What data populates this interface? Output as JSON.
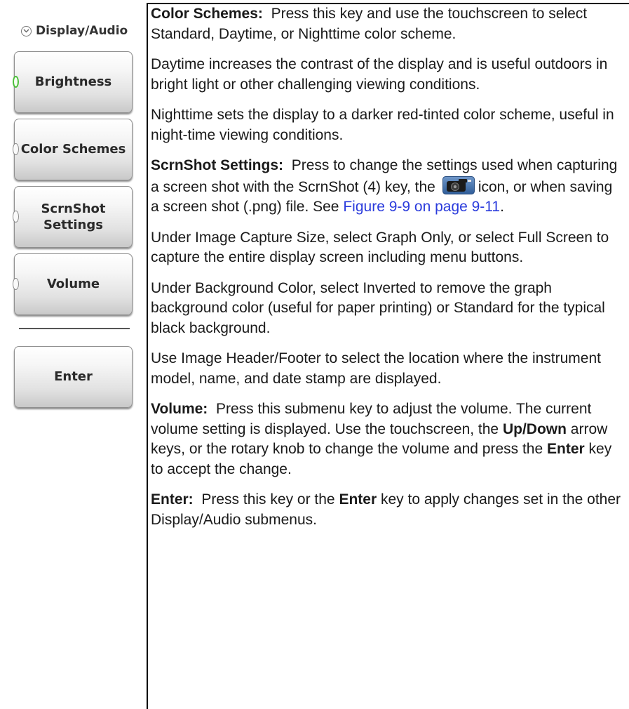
{
  "menu": {
    "title": "Display/Audio",
    "items": [
      {
        "label": "Brightness",
        "active": true
      },
      {
        "label": "Color Schemes",
        "active": false
      },
      {
        "label": "ScrnShot\nSettings",
        "active": false
      },
      {
        "label": "Volume",
        "active": false
      }
    ],
    "enter_label": "Enter"
  },
  "doc": {
    "color_schemes": {
      "term": "Color Schemes:",
      "text": "Press this key and use the touchscreen to select Standard, Daytime, or Nighttime color scheme."
    },
    "daytime_text": "Daytime increases the contrast of the display and is useful outdoors in bright light or other challenging viewing conditions.",
    "nighttime_text": "Nighttime sets the display to a darker red-tinted color scheme, useful in night-time viewing conditions.",
    "scrnshot": {
      "term": "ScrnShot Settings:",
      "text_before_icon": "Press to change the settings used when capturing a screen shot with the ScrnShot (4) key, the",
      "text_after_icon": "icon, or when saving a screen shot (.png) file.",
      "see": "See",
      "link": "Figure 9-9 on page 9-11",
      "period": "."
    },
    "image_capture_text": "Under Image Capture Size, select Graph Only, or select Full Screen to capture the entire display screen including menu buttons.",
    "background_color_text": "Under Background Color, select Inverted to remove the graph background color (useful for paper printing) or Standard for the typical black background.",
    "header_footer_text": "Use Image Header/Footer to select the location where the instrument model, name, and date stamp are displayed.",
    "volume": {
      "term": "Volume:",
      "text1": "Press this submenu key to adjust the volume. The current volume setting is displayed. Use the touchscreen, the",
      "bold1": "Up/Down",
      "text2": "arrow keys, or the rotary knob to change the volume and press the",
      "bold2": "Enter",
      "text3": "key to accept the change."
    },
    "enter": {
      "term": "Enter:",
      "text1": "Press this key or the",
      "bold1": "Enter",
      "text2": "key to apply changes set in the other Display/Audio submenus."
    }
  },
  "colors": {
    "link": "#2a3bdc",
    "led_active": "#4bbf3a"
  },
  "icons": [
    "chevron-down-icon",
    "camera-icon"
  ]
}
